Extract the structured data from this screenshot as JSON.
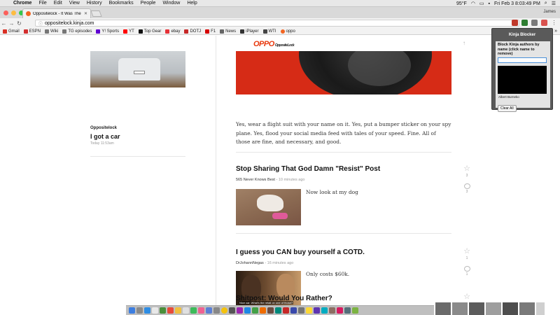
{
  "menubar": {
    "app": "Chrome",
    "items": [
      "File",
      "Edit",
      "View",
      "History",
      "Bookmarks",
      "People",
      "Window",
      "Help"
    ],
    "temperature": "95°F",
    "datetime": "Fri Feb 3  8:03:49 PM"
  },
  "browser": {
    "tab_title": "Oppositelock - It Was The Be",
    "user": "James",
    "url": "oppositelock.kinja.com",
    "bookmarks": [
      {
        "label": "Gmail",
        "icon": "gmail-icon",
        "color": "#d93025"
      },
      {
        "label": "ESPN",
        "icon": "espn-icon",
        "color": "#d32f2f"
      },
      {
        "label": "Wiki",
        "icon": "wikipedia-icon",
        "color": "#555555"
      },
      {
        "label": "TG episodes",
        "icon": "wikipedia-icon",
        "color": "#555555"
      },
      {
        "label": "Y! Sports",
        "icon": "yahoo-icon",
        "color": "#5f01d1"
      },
      {
        "label": "YT",
        "icon": "youtube-icon",
        "color": "#ff0000"
      },
      {
        "label": "Top Gear",
        "icon": "topgear-icon",
        "color": "#111111"
      },
      {
        "label": "ebay",
        "icon": "ebay-icon",
        "color": "#e53238"
      },
      {
        "label": "DOTJ",
        "icon": "dotj-icon",
        "color": "#c62828"
      },
      {
        "label": "F1",
        "icon": "f1-icon",
        "color": "#d50000"
      },
      {
        "label": "News",
        "icon": "news-icon",
        "color": "#666666"
      },
      {
        "label": "iPlayer",
        "icon": "iplayer-icon",
        "color": "#333333"
      },
      {
        "label": "WTI",
        "icon": "wti-icon",
        "color": "#444444"
      },
      {
        "label": "oppo",
        "icon": "oppo-icon",
        "color": "#f26522"
      }
    ]
  },
  "site": {
    "logo": "OPPO",
    "logo_sub": "OppositeLock"
  },
  "sidebar_post": {
    "category": "Oppositelock",
    "title": "I got a car",
    "time": "Today 11:53am"
  },
  "main": {
    "lead_paragraph": "Yes, wear a flight suit with your name on it. Yes, put a bumper sticker on your spy plane. Yes, flood your social media feed with tales of your speed. Fine. All of those are fine, and necessary, and good.",
    "posts": [
      {
        "title": "Stop Sharing That God Damn \"Resist\" Post",
        "author": "565 Never Knows Best",
        "time": "10 minutes ago",
        "excerpt": "Now look at my dog",
        "stars": "3",
        "comments": "3"
      },
      {
        "title": "I guess you CAN buy yourself a COTD.",
        "author": "DrJohannNegas",
        "time": "16 minutes ago",
        "excerpt": "Only costs $60k.",
        "image_caption": "Nice car. What's the retail on one of those?",
        "stars": "1",
        "comments": "1"
      },
      {
        "title": "Shitpost: Would You Rather?"
      }
    ]
  },
  "extension": {
    "title": "Kinja Blocker",
    "label": "Block Kinja authors by name (click name to remove)",
    "blocked_authors": [
      "Albert Burneko"
    ],
    "clear_button": "Clear All"
  },
  "colors": {
    "accent": "#e8380d",
    "hero_red": "#d62b16"
  }
}
